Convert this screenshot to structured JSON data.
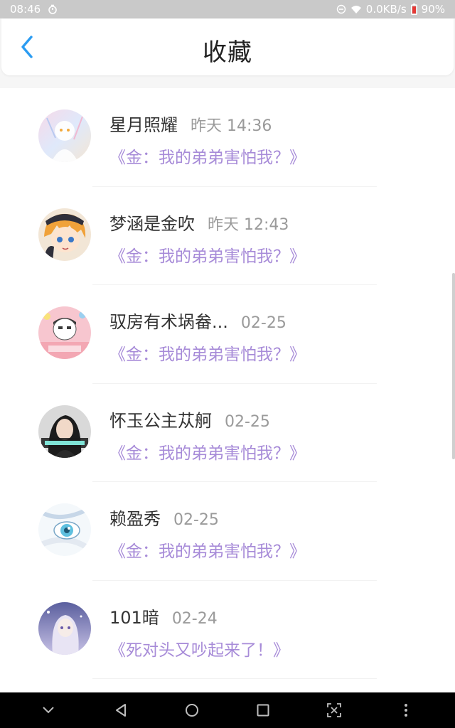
{
  "status_bar": {
    "time": "08:46",
    "network_speed": "0.0KB/s",
    "battery": "90%",
    "icons": [
      "stopwatch-icon",
      "dnd-icon",
      "wifi-icon",
      "battery-icon"
    ]
  },
  "header": {
    "title": "收藏",
    "back_icon": "chevron-left-icon"
  },
  "colors": {
    "accent": "#2b9cf2",
    "book_title": "#a78bd8",
    "time_text": "#9a9a9a",
    "name_text": "#333333",
    "status_bar_bg": "#c9c9c9",
    "nav_bar_bg": "#000000"
  },
  "items": [
    {
      "name": "星月照耀",
      "time": "昨天 14:36",
      "book": "《金：我的弟弟害怕我？》",
      "avatar": "avatar-pastel-anime"
    },
    {
      "name": "梦涵是金吹",
      "time": "昨天 12:43",
      "book": "《金：我的弟弟害怕我？》",
      "avatar": "avatar-orange-hair-anime"
    },
    {
      "name": "驭房有术埚畚...",
      "time": "02-25",
      "book": "《金：我的弟弟害怕我？》",
      "avatar": "avatar-pink-cartoon"
    },
    {
      "name": "怀玉公主苁舸",
      "time": "02-25",
      "book": "《金：我的弟弟害怕我？》",
      "avatar": "avatar-girl-photo"
    },
    {
      "name": "赖盈秀",
      "time": "02-25",
      "book": "《金：我的弟弟害怕我？》",
      "avatar": "avatar-blue-eye"
    },
    {
      "name": "101暗",
      "time": "02-24",
      "book": "《死对头又吵起来了！》",
      "avatar": "avatar-purple-anime"
    }
  ],
  "nav_bar": {
    "buttons": [
      "chevron-down-icon",
      "back-triangle-icon",
      "home-circle-icon",
      "recents-square-icon",
      "screenshot-icon",
      "more-vertical-icon"
    ]
  }
}
